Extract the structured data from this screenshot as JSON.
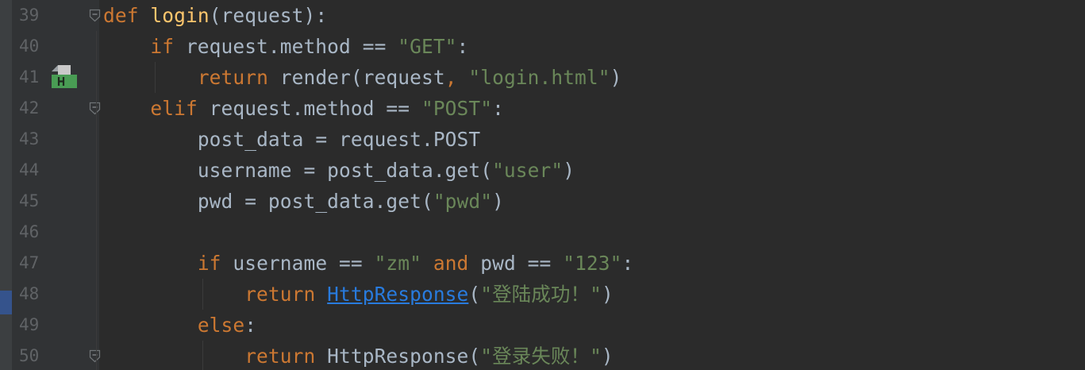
{
  "editor": {
    "language": "python",
    "colors": {
      "background": "#2b2b2b",
      "gutter": "#313335",
      "line_number": "#606366",
      "default_text": "#a9b7c6",
      "keyword": "#cc7832",
      "function_name": "#ffc66d",
      "string": "#6a8759",
      "link": "#287bde",
      "bookmark": "#499c54"
    },
    "gutter_icons": [
      {
        "line": 39,
        "icon": "fold-open-icon"
      },
      {
        "line": 41,
        "icon": "html-bookmark-icon"
      },
      {
        "line": 42,
        "icon": "fold-open-icon"
      },
      {
        "line": 50,
        "icon": "fold-open-icon"
      }
    ],
    "lines": [
      {
        "number": "39",
        "indent": "",
        "tokens": [
          {
            "text": "def",
            "style": "kw"
          },
          {
            "text": " ",
            "style": ""
          },
          {
            "text": "login",
            "style": "fn"
          },
          {
            "text": "(request):",
            "style": ""
          }
        ]
      },
      {
        "number": "40",
        "indent": "    ",
        "tokens": [
          {
            "text": "if",
            "style": "kw"
          },
          {
            "text": " request.method == ",
            "style": ""
          },
          {
            "text": "\"GET\"",
            "style": "str"
          },
          {
            "text": ":",
            "style": ""
          }
        ]
      },
      {
        "number": "41",
        "indent": "        ",
        "tokens": [
          {
            "text": "return",
            "style": "kw"
          },
          {
            "text": " render(request",
            "style": ""
          },
          {
            "text": ",",
            "style": "kw"
          },
          {
            "text": " ",
            "style": ""
          },
          {
            "text": "\"login.html\"",
            "style": "str"
          },
          {
            "text": ")",
            "style": ""
          }
        ]
      },
      {
        "number": "42",
        "indent": "    ",
        "tokens": [
          {
            "text": "elif",
            "style": "kw"
          },
          {
            "text": " request.method == ",
            "style": ""
          },
          {
            "text": "\"POST\"",
            "style": "str"
          },
          {
            "text": ":",
            "style": ""
          }
        ]
      },
      {
        "number": "43",
        "indent": "        ",
        "tokens": [
          {
            "text": "post_data = request.POST",
            "style": ""
          }
        ]
      },
      {
        "number": "44",
        "indent": "        ",
        "tokens": [
          {
            "text": "username = post_data.get(",
            "style": ""
          },
          {
            "text": "\"user\"",
            "style": "str"
          },
          {
            "text": ")",
            "style": ""
          }
        ]
      },
      {
        "number": "45",
        "indent": "        ",
        "tokens": [
          {
            "text": "pwd = post_data.get(",
            "style": ""
          },
          {
            "text": "\"pwd\"",
            "style": "str"
          },
          {
            "text": ")",
            "style": ""
          }
        ]
      },
      {
        "number": "46",
        "indent": "",
        "tokens": []
      },
      {
        "number": "47",
        "indent": "        ",
        "tokens": [
          {
            "text": "if",
            "style": "kw"
          },
          {
            "text": " username == ",
            "style": ""
          },
          {
            "text": "\"zm\"",
            "style": "str"
          },
          {
            "text": " ",
            "style": ""
          },
          {
            "text": "and",
            "style": "kw"
          },
          {
            "text": " pwd == ",
            "style": ""
          },
          {
            "text": "\"123\"",
            "style": "str"
          },
          {
            "text": ":",
            "style": ""
          }
        ]
      },
      {
        "number": "48",
        "indent": "            ",
        "tokens": [
          {
            "text": "return",
            "style": "kw"
          },
          {
            "text": " ",
            "style": ""
          },
          {
            "text": "HttpResponse",
            "style": "link"
          },
          {
            "text": "(",
            "style": ""
          },
          {
            "text": "\"登陆成功！\"",
            "style": "str"
          },
          {
            "text": ")",
            "style": ""
          }
        ]
      },
      {
        "number": "49",
        "indent": "        ",
        "tokens": [
          {
            "text": "else",
            "style": "kw"
          },
          {
            "text": ":",
            "style": ""
          }
        ]
      },
      {
        "number": "50",
        "indent": "            ",
        "tokens": [
          {
            "text": "return",
            "style": "kw"
          },
          {
            "text": " HttpResponse(",
            "style": ""
          },
          {
            "text": "\"登录失败！\"",
            "style": "str"
          },
          {
            "text": ")",
            "style": ""
          }
        ]
      }
    ]
  }
}
